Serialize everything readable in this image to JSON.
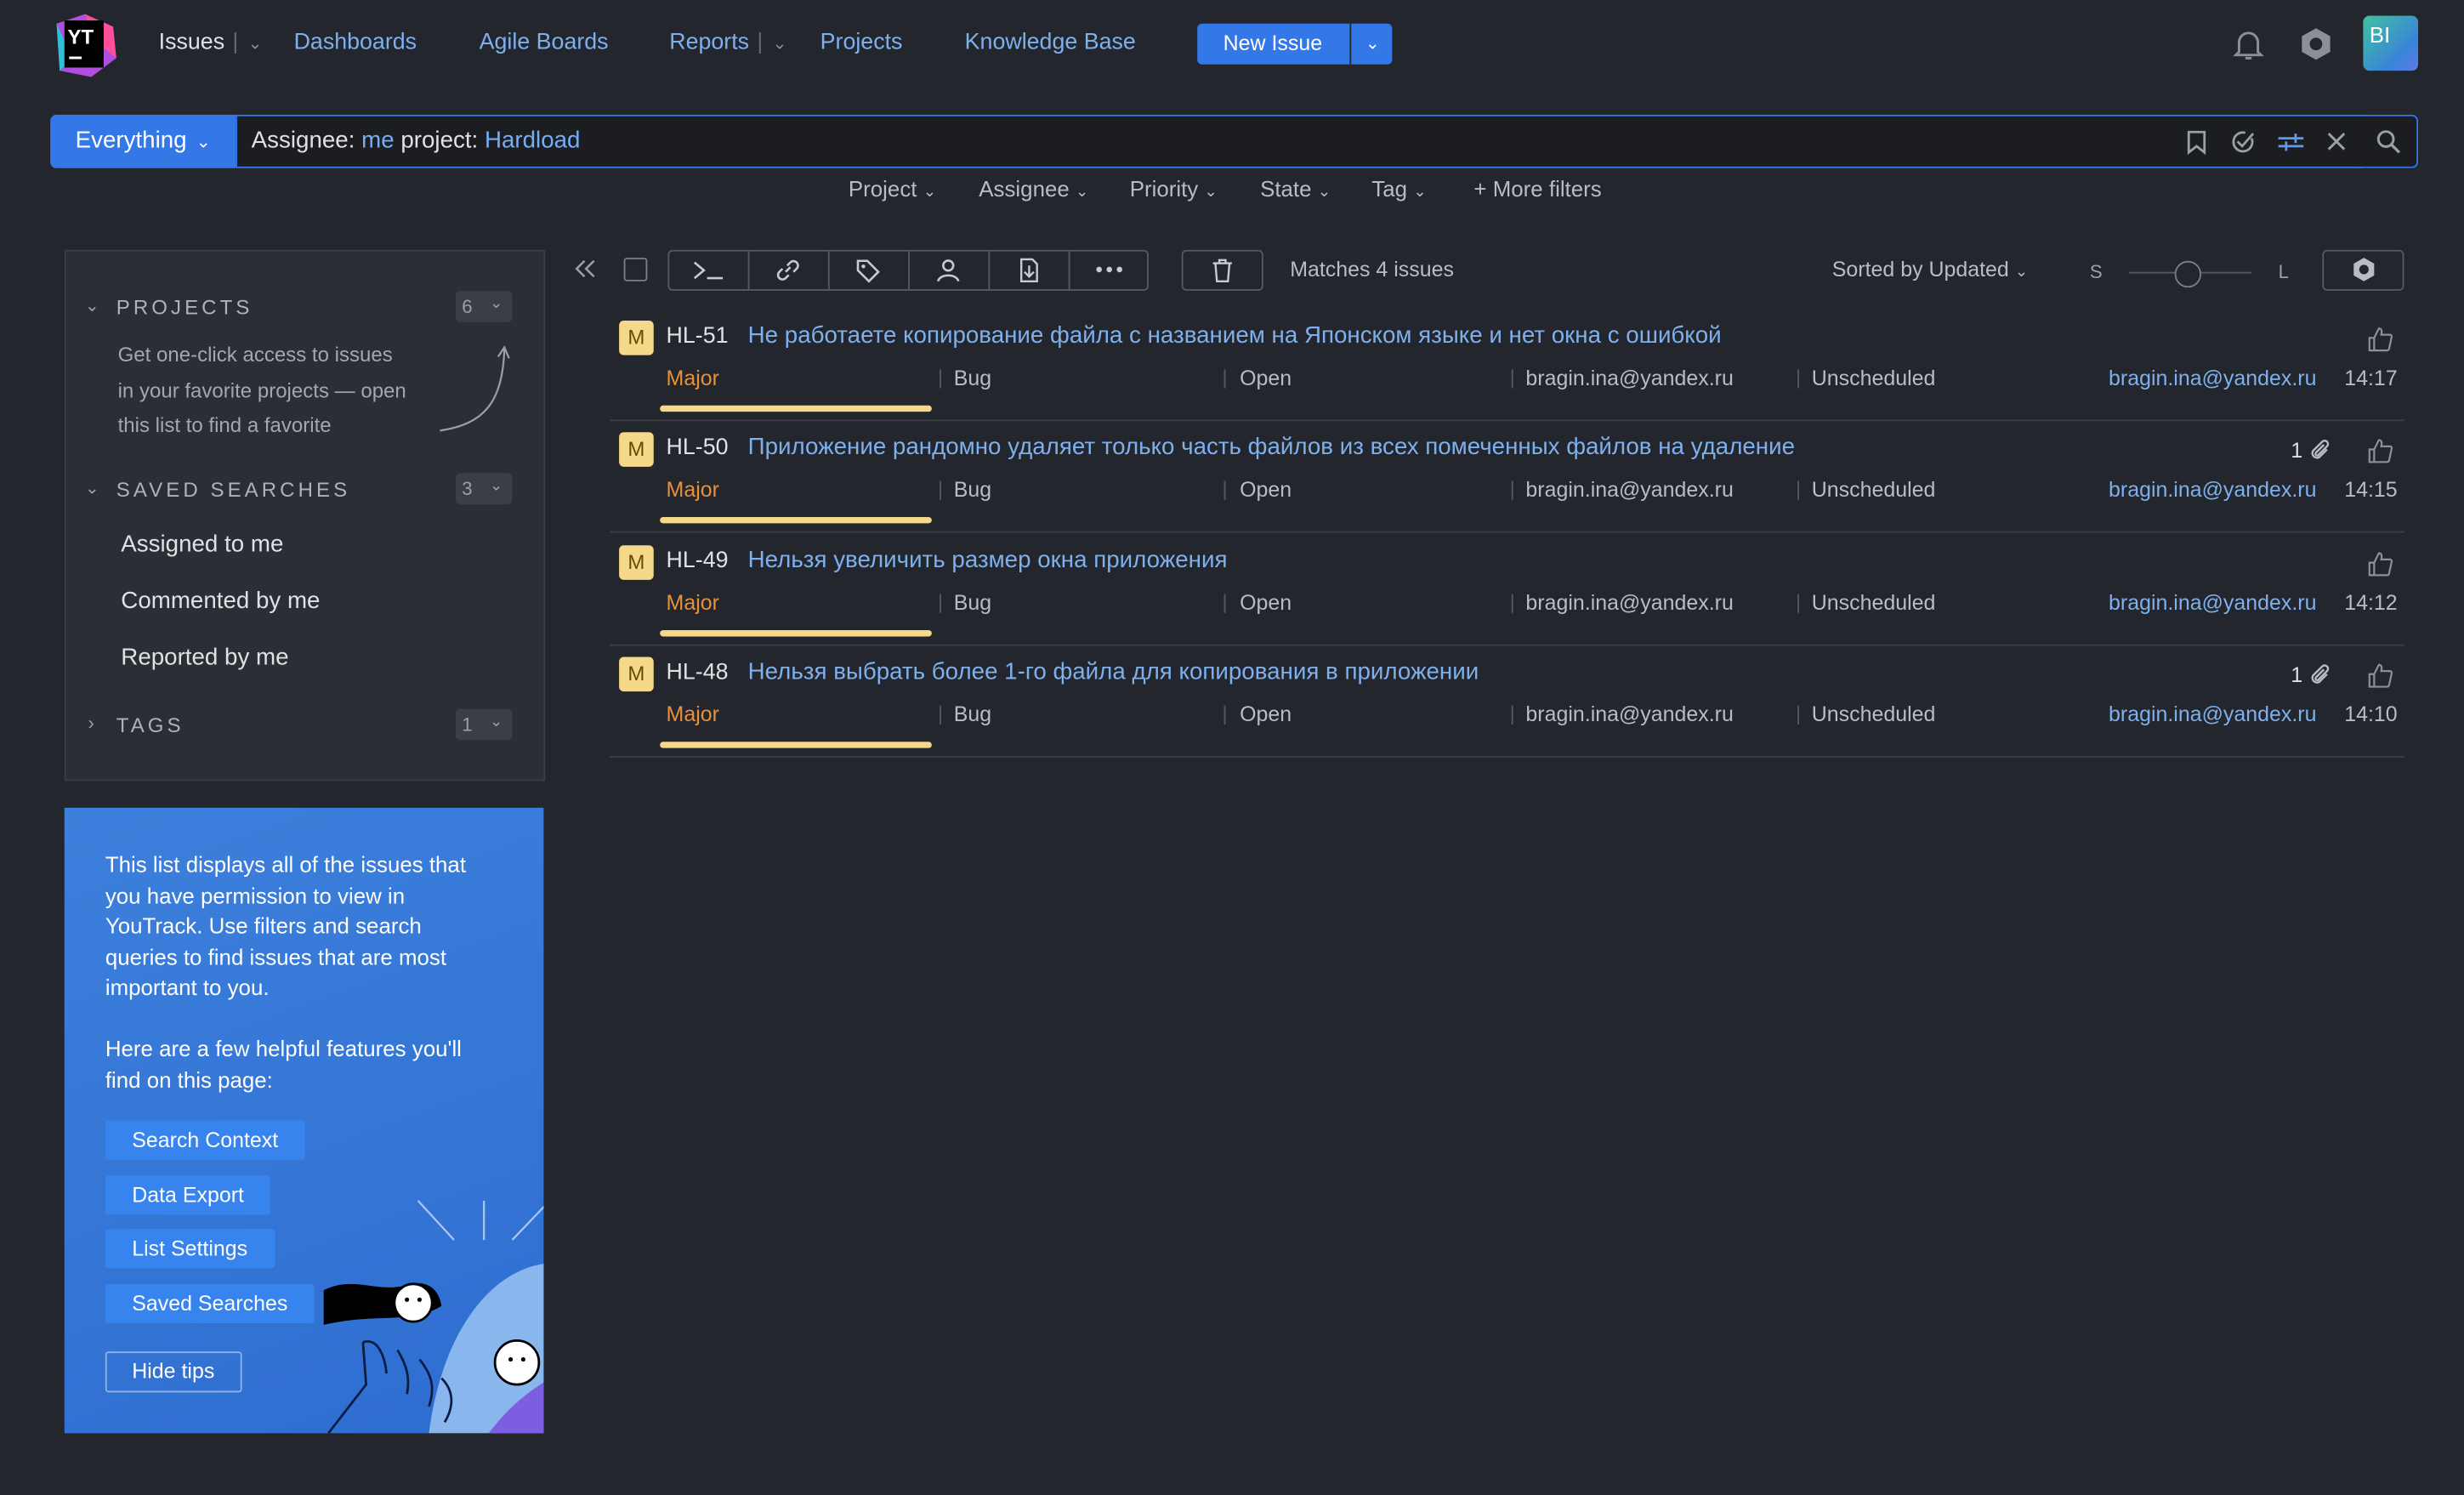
{
  "header": {
    "logo_text": "YT",
    "nav": {
      "issues": "Issues",
      "dashboards": "Dashboards",
      "agile_boards": "Agile Boards",
      "reports": "Reports",
      "projects": "Projects",
      "knowledge_base": "Knowledge Base"
    },
    "new_issue": "New Issue",
    "avatar_initials": "BI"
  },
  "search": {
    "context": "Everything",
    "query_prefix": "Assignee: ",
    "query_assignee": "me",
    "query_mid": " project: ",
    "query_project": "Hardload"
  },
  "filters": [
    "Project",
    "Assignee",
    "Priority",
    "State",
    "Tag"
  ],
  "more_filters": "More filters",
  "sidebar": {
    "projects_title": "PROJECTS",
    "projects_count": "6",
    "projects_hint": [
      "Get one-click access to issues",
      "in your favorite projects — open",
      "this list to find a favorite"
    ],
    "saved_title": "SAVED SEARCHES",
    "saved_count": "3",
    "saved": [
      "Assigned to me",
      "Commented by me",
      "Reported by me"
    ],
    "tags_title": "TAGS",
    "tags_count": "1"
  },
  "tips": {
    "para1": "This list displays all of the issues that you have permission to view in YouTrack. Use filters and search queries to find issues that are most important to you.",
    "para2": "Here are a few helpful features you'll find on this page:",
    "buttons": [
      "Search Context",
      "Data Export",
      "List Settings",
      "Saved Searches"
    ],
    "hide": "Hide tips"
  },
  "toolbar": {
    "matches": "Matches 4 issues",
    "sorted": "Sorted by Updated",
    "size_s": "S",
    "size_l": "L"
  },
  "issues": [
    {
      "badge": "M",
      "id": "HL-51",
      "title": "Не работаете копирование файла с названием на Японском языке и нет окна с ошибкой",
      "priority": "Major",
      "type": "Bug",
      "state": "Open",
      "assignee": "bragin.ina@yandex.ru",
      "sprint": "Unscheduled",
      "reporter": "bragin.ina@yandex.ru",
      "time": "14:17",
      "attachments": ""
    },
    {
      "badge": "M",
      "id": "HL-50",
      "title": "Приложение рандомно удаляет только часть файлов из всех помеченных файлов на удаление",
      "priority": "Major",
      "type": "Bug",
      "state": "Open",
      "assignee": "bragin.ina@yandex.ru",
      "sprint": "Unscheduled",
      "reporter": "bragin.ina@yandex.ru",
      "time": "14:15",
      "attachments": "1"
    },
    {
      "badge": "M",
      "id": "HL-49",
      "title": "Нельзя увеличить размер окна приложения",
      "priority": "Major",
      "type": "Bug",
      "state": "Open",
      "assignee": "bragin.ina@yandex.ru",
      "sprint": "Unscheduled",
      "reporter": "bragin.ina@yandex.ru",
      "time": "14:12",
      "attachments": ""
    },
    {
      "badge": "M",
      "id": "HL-48",
      "title": "Нельзя выбрать более 1-го файла для копирования в приложении",
      "priority": "Major",
      "type": "Bug",
      "state": "Open",
      "assignee": "bragin.ina@yandex.ru",
      "sprint": "Unscheduled",
      "reporter": "bragin.ina@yandex.ru",
      "time": "14:10",
      "attachments": "1"
    }
  ],
  "colors": {
    "accent": "#3478e8",
    "link": "#7fb0ee",
    "priority_major": "#e8913a",
    "badge_yellow": "#f5d88a",
    "background": "#23262c"
  }
}
